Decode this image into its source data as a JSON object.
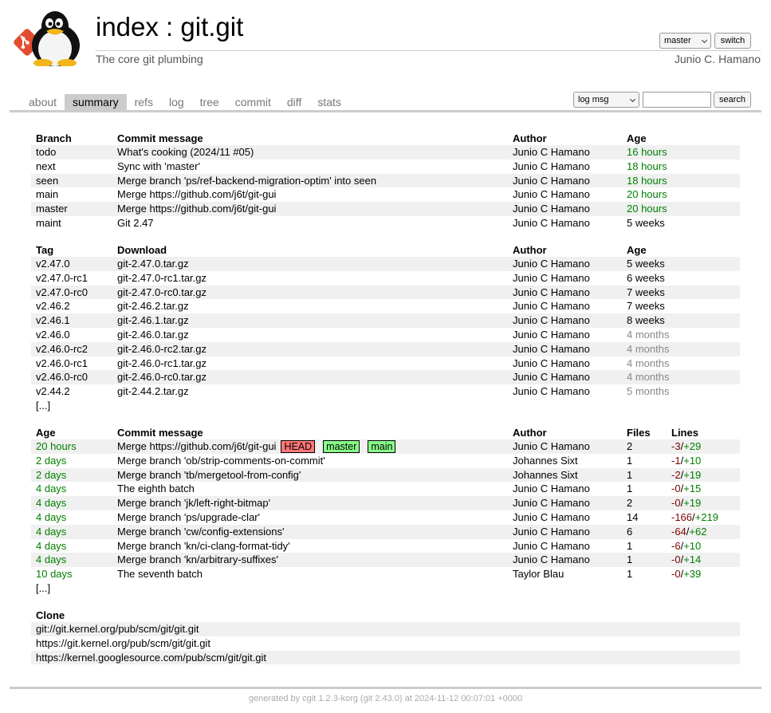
{
  "header": {
    "title": "index : git.git",
    "description": "The core git plumbing",
    "owner": "Junio C. Hamano",
    "branch_select": "master",
    "switch_label": "switch"
  },
  "tabs": [
    "about",
    "summary",
    "refs",
    "log",
    "tree",
    "commit",
    "diff",
    "stats"
  ],
  "active_tab": "summary",
  "search": {
    "select": "log msg",
    "value": "",
    "button": "search"
  },
  "branches": {
    "headers": [
      "Branch",
      "Commit message",
      "Author",
      "Age"
    ],
    "rows": [
      {
        "name": "todo",
        "msg": "What's cooking (2024/11 #05)",
        "author": "Junio C Hamano",
        "age": "16 hours",
        "age_style": "green"
      },
      {
        "name": "next",
        "msg": "Sync with 'master'",
        "author": "Junio C Hamano",
        "age": "18 hours",
        "age_style": "green"
      },
      {
        "name": "seen",
        "msg": "Merge branch 'ps/ref-backend-migration-optim' into seen",
        "author": "Junio C Hamano",
        "age": "18 hours",
        "age_style": "green"
      },
      {
        "name": "main",
        "msg": "Merge https://github.com/j6t/git-gui",
        "author": "Junio C Hamano",
        "age": "20 hours",
        "age_style": "green"
      },
      {
        "name": "master",
        "msg": "Merge https://github.com/j6t/git-gui",
        "author": "Junio C Hamano",
        "age": "20 hours",
        "age_style": "green"
      },
      {
        "name": "maint",
        "msg": "Git 2.47",
        "author": "Junio C Hamano",
        "age": "5 weeks",
        "age_style": "black"
      }
    ]
  },
  "tags": {
    "headers": [
      "Tag",
      "Download",
      "Author",
      "Age"
    ],
    "rows": [
      {
        "name": "v2.47.0",
        "download": "git-2.47.0.tar.gz",
        "author": "Junio C Hamano",
        "age": "5 weeks",
        "age_style": "black"
      },
      {
        "name": "v2.47.0-rc1",
        "download": "git-2.47.0-rc1.tar.gz",
        "author": "Junio C Hamano",
        "age": "6 weeks",
        "age_style": "black"
      },
      {
        "name": "v2.47.0-rc0",
        "download": "git-2.47.0-rc0.tar.gz",
        "author": "Junio C Hamano",
        "age": "7 weeks",
        "age_style": "black"
      },
      {
        "name": "v2.46.2",
        "download": "git-2.46.2.tar.gz",
        "author": "Junio C Hamano",
        "age": "7 weeks",
        "age_style": "black"
      },
      {
        "name": "v2.46.1",
        "download": "git-2.46.1.tar.gz",
        "author": "Junio C Hamano",
        "age": "8 weeks",
        "age_style": "black"
      },
      {
        "name": "v2.46.0",
        "download": "git-2.46.0.tar.gz",
        "author": "Junio C Hamano",
        "age": "4 months",
        "age_style": "grey"
      },
      {
        "name": "v2.46.0-rc2",
        "download": "git-2.46.0-rc2.tar.gz",
        "author": "Junio C Hamano",
        "age": "4 months",
        "age_style": "grey"
      },
      {
        "name": "v2.46.0-rc1",
        "download": "git-2.46.0-rc1.tar.gz",
        "author": "Junio C Hamano",
        "age": "4 months",
        "age_style": "grey"
      },
      {
        "name": "v2.46.0-rc0",
        "download": "git-2.46.0-rc0.tar.gz",
        "author": "Junio C Hamano",
        "age": "4 months",
        "age_style": "grey"
      },
      {
        "name": "v2.44.2",
        "download": "git-2.44.2.tar.gz",
        "author": "Junio C Hamano",
        "age": "5 months",
        "age_style": "grey"
      }
    ],
    "more": "[...]"
  },
  "commits": {
    "headers": [
      "Age",
      "Commit message",
      "Author",
      "Files",
      "Lines"
    ],
    "rows": [
      {
        "age": "20 hours",
        "msg": "Merge https://github.com/j6t/git-gui",
        "decorations": [
          {
            "label": "HEAD",
            "kind": "head"
          },
          {
            "label": "master",
            "kind": "branch"
          },
          {
            "label": "main",
            "kind": "branch"
          }
        ],
        "author": "Junio C Hamano",
        "files": "2",
        "del": "-3",
        "add": "+29"
      },
      {
        "age": "2 days",
        "msg": "Merge branch 'ob/strip-comments-on-commit'",
        "decorations": [],
        "author": "Johannes Sixt",
        "files": "1",
        "del": "-1",
        "add": "+10"
      },
      {
        "age": "2 days",
        "msg": "Merge branch 'tb/mergetool-from-config'",
        "decorations": [],
        "author": "Johannes Sixt",
        "files": "1",
        "del": "-2",
        "add": "+19"
      },
      {
        "age": "4 days",
        "msg": "The eighth batch",
        "decorations": [],
        "author": "Junio C Hamano",
        "files": "1",
        "del": "-0",
        "add": "+15"
      },
      {
        "age": "4 days",
        "msg": "Merge branch 'jk/left-right-bitmap'",
        "decorations": [],
        "author": "Junio C Hamano",
        "files": "2",
        "del": "-0",
        "add": "+19"
      },
      {
        "age": "4 days",
        "msg": "Merge branch 'ps/upgrade-clar'",
        "decorations": [],
        "author": "Junio C Hamano",
        "files": "14",
        "del": "-166",
        "add": "+219"
      },
      {
        "age": "4 days",
        "msg": "Merge branch 'cw/config-extensions'",
        "decorations": [],
        "author": "Junio C Hamano",
        "files": "6",
        "del": "-64",
        "add": "+62"
      },
      {
        "age": "4 days",
        "msg": "Merge branch 'kn/ci-clang-format-tidy'",
        "decorations": [],
        "author": "Junio C Hamano",
        "files": "1",
        "del": "-6",
        "add": "+10"
      },
      {
        "age": "4 days",
        "msg": "Merge branch 'kn/arbitrary-suffixes'",
        "decorations": [],
        "author": "Junio C Hamano",
        "files": "1",
        "del": "-0",
        "add": "+14"
      },
      {
        "age": "10 days",
        "msg": "The seventh batch",
        "decorations": [],
        "author": "Taylor Blau",
        "files": "1",
        "del": "-0",
        "add": "+39"
      }
    ],
    "more": "[...]"
  },
  "clone": {
    "header": "Clone",
    "urls": [
      "git://git.kernel.org/pub/scm/git/git.git",
      "https://git.kernel.org/pub/scm/git/git.git",
      "https://kernel.googlesource.com/pub/scm/git/git.git"
    ]
  },
  "footer": "generated by cgit 1.2.3-korg (git 2.43.0) at 2024-11-12 00:07:01 +0000",
  "colors": {
    "age_recent": "#008000",
    "age_old": "#888888",
    "head_decor": "#ff7777",
    "branch_decor": "#88ff88",
    "del": "#800000",
    "add": "#008000"
  }
}
